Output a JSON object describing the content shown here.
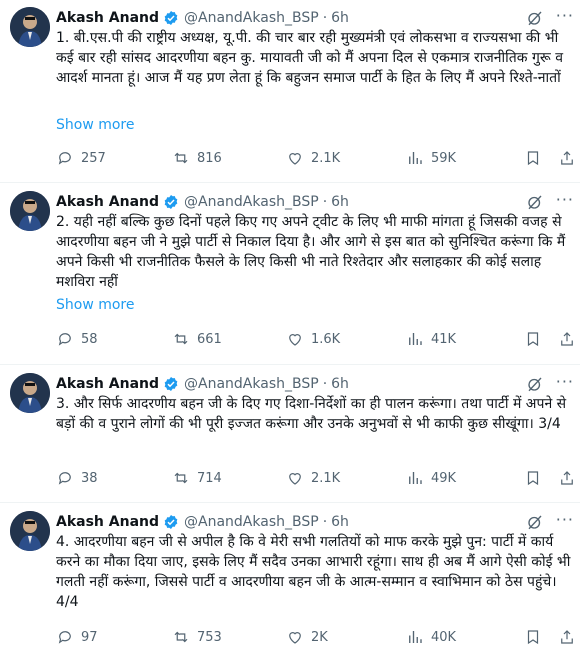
{
  "tweets": [
    {
      "name": "Akash Anand",
      "handle": "@AnandAkash_BSP",
      "dot": "·",
      "time": "6h",
      "text": "1. बी.एस.पी की राष्ट्रीय अध्यक्ष, यू.पी. की चार बार रही मुख्यमंत्री एवं लोकसभा व राज्यसभा की भी कई बार रही सांसद आदरणीया बहन कु. मायावती जी को मैं अपना दिल से एकमात्र राजनीतिक गुरू व आदर्श मानता हूं। आज मैं यह प्रण लेता हूं कि बहुजन समाज पार्टी के हित के लिए मैं अपने रिश्ते-नातों",
      "show_more": "Show more",
      "replies": "257",
      "reposts": "816",
      "likes": "2.1K",
      "views": "59K"
    },
    {
      "name": "Akash Anand",
      "handle": "@AnandAkash_BSP",
      "dot": "·",
      "time": "6h",
      "text": "2. यही नहीं बल्कि कुछ दिनों पहले किए गए अपने ट्वीट के लिए भी माफी मांगता हूं जिसकी वजह से आदरणीया बहन जी ने मुझे पार्टी से निकाल दिया है। और आगे से इस बात को सुनिश्चित करूंगा कि मैं अपने किसी भी राजनीतिक फैसले के लिए किसी भी नाते रिश्तेदार और सलाहकार की कोई सलाह मशविरा नहीं",
      "show_more": "Show more",
      "replies": "58",
      "reposts": "661",
      "likes": "1.6K",
      "views": "41K"
    },
    {
      "name": "Akash Anand",
      "handle": "@AnandAkash_BSP",
      "dot": "·",
      "time": "6h",
      "text": "3. और सिर्फ आदरणीय बहन जी के दिए गए दिशा-निर्देशों का ही पालन करूंगा। तथा पार्टी में अपने से बड़ों की व पुराने लोगों की भी पूरी इज्जत करूंगा और उनके अनुभवों से भी काफी कुछ सीखूंगा। 3/4",
      "show_more": "",
      "replies": "38",
      "reposts": "714",
      "likes": "2.1K",
      "views": "49K"
    },
    {
      "name": "Akash Anand",
      "handle": "@AnandAkash_BSP",
      "dot": "·",
      "time": "6h",
      "text": "4. आदरणीया बहन जी से अपील है कि वे मेरी सभी गलतियों को माफ करके मुझे पुन: पार्टी में कार्य करने का मौका दिया जाए, इसके लिए मैं सदैव उनका आभारी रहूंगा। साथ ही अब मैं आगे ऐसी कोई भी गलती नहीं करूंगा, जिससे पार्टी व आदरणीया बहन जी के आत्म-सम्मान व स्वाभिमान को ठेस पहुंचे। 4/4",
      "show_more": "",
      "replies": "97",
      "reposts": "753",
      "likes": "2K",
      "views": "40K"
    }
  ],
  "colors": {
    "text": "#0f1419",
    "secondary": "#536471",
    "link": "#1d9bf0",
    "verified": "#1d9bf0",
    "divider": "#eff3f4"
  },
  "icons": [
    "verified-badge-icon",
    "grok-icon",
    "more-icon",
    "reply-icon",
    "repost-icon",
    "like-icon",
    "views-icon",
    "bookmark-icon",
    "share-icon"
  ]
}
